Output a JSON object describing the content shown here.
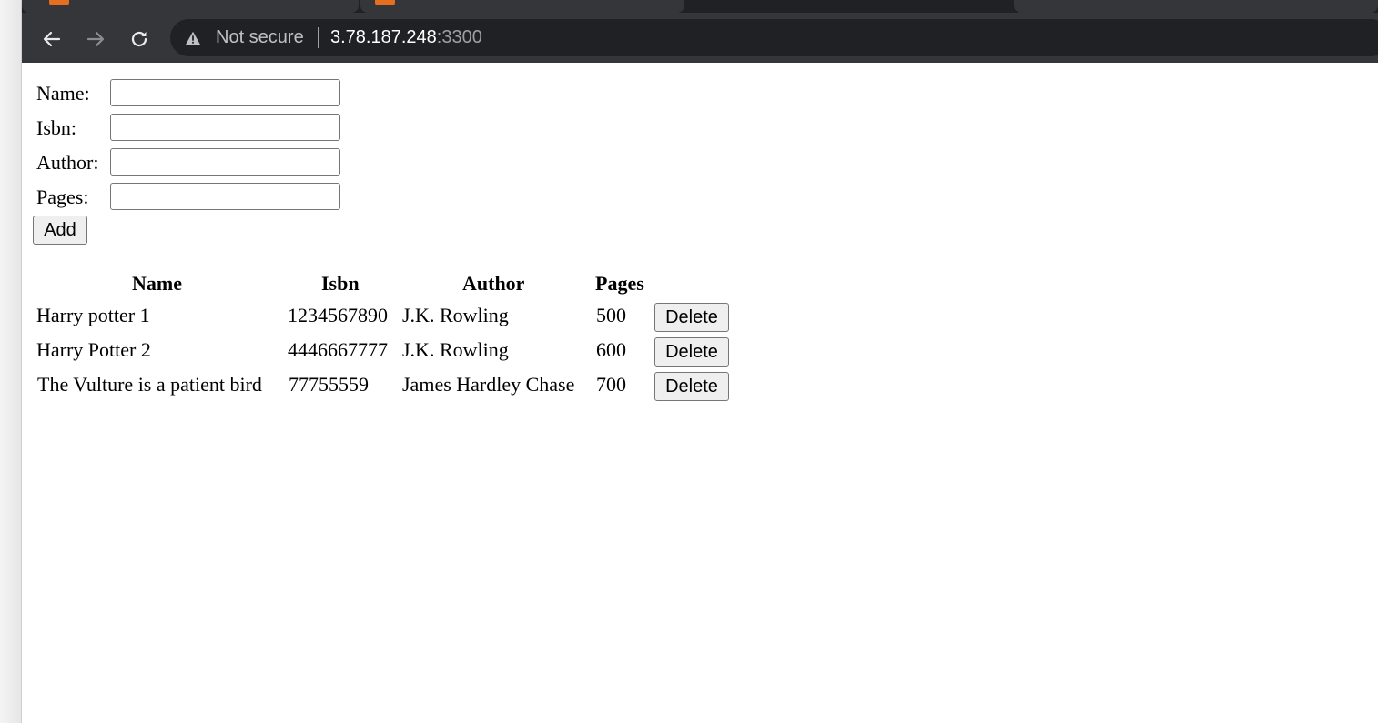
{
  "browser": {
    "security_label": "Not secure",
    "url_host": "3.78.187.248",
    "url_port": ":3300",
    "icons": {
      "back": "arrow-left-icon",
      "forward": "arrow-right-icon",
      "reload": "reload-icon",
      "security": "warning-triangle-icon"
    }
  },
  "form": {
    "name_label": "Name:",
    "isbn_label": "Isbn:",
    "author_label": "Author:",
    "pages_label": "Pages:",
    "name_value": "",
    "isbn_value": "",
    "author_value": "",
    "pages_value": "",
    "add_label": "Add"
  },
  "table": {
    "headers": {
      "name": "Name",
      "isbn": "Isbn",
      "author": "Author",
      "pages": "Pages"
    },
    "rows": [
      {
        "name": "Harry potter 1",
        "isbn": "1234567890",
        "author": "J.K. Rowling",
        "pages": "500",
        "action": "Delete"
      },
      {
        "name": "Harry Potter 2",
        "isbn": "4446667777",
        "author": "J.K. Rowling",
        "pages": "600",
        "action": "Delete"
      },
      {
        "name": "The Vulture is a patient bird",
        "isbn": "77755559",
        "author": "James Hardley Chase",
        "pages": "700",
        "action": "Delete"
      }
    ]
  }
}
